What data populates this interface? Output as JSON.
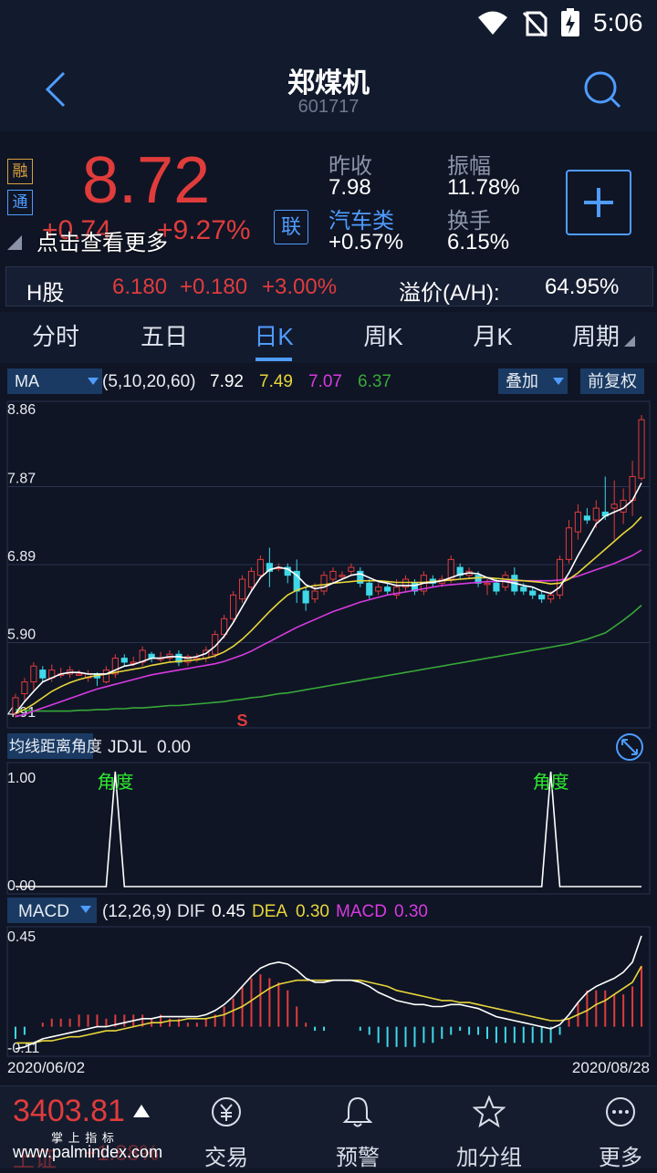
{
  "status": {
    "time": "5:06"
  },
  "header": {
    "title": "郑煤机",
    "code": "601717",
    "back_icon": "back-arrow-icon",
    "search_icon": "search-icon"
  },
  "quote": {
    "badge_rong": "融",
    "badge_tong": "通",
    "price": "8.72",
    "change": "+0.74",
    "change_pct": "+9.27%",
    "more_text": "点击查看更多",
    "lian_badge": "联",
    "prev_close_label": "昨收",
    "prev_close": "7.98",
    "amplitude_label": "振幅",
    "amplitude": "11.78%",
    "sector_label": "汽车类",
    "sector_change": "+0.57%",
    "turnover_label": "换手",
    "turnover": "6.15%",
    "add_icon": "plus-icon"
  },
  "hshare": {
    "label": "H股",
    "price": "6.180",
    "change": "+0.180",
    "change_pct": "+3.00%",
    "premium_label": "溢价(A/H):",
    "premium": "64.95%"
  },
  "tabs": [
    {
      "label": "分时"
    },
    {
      "label": "五日"
    },
    {
      "label": "日K"
    },
    {
      "label": "周K"
    },
    {
      "label": "月K"
    },
    {
      "label": "周期"
    }
  ],
  "ma": {
    "label": "MA",
    "params": "(5,10,20,60)",
    "v5": "7.92",
    "v10": "7.49",
    "v20": "7.07",
    "v60": "6.37",
    "overlay": "叠加",
    "adjust": "前复权"
  },
  "colors": {
    "up": "#e03c3c",
    "down": "#3fd8e8",
    "ma5": "#ffffff",
    "ma10": "#e8d53a",
    "ma20": "#d83ae0",
    "ma60": "#38a838"
  },
  "chart_data": [
    {
      "type": "candlestick",
      "yticks": [
        "8.86",
        "7.87",
        "6.89",
        "5.90",
        "4.91"
      ],
      "ylim": [
        4.91,
        8.86
      ],
      "candles": [
        [
          5.0,
          5.2,
          4.95,
          5.25
        ],
        [
          5.25,
          5.4,
          5.15,
          5.45
        ],
        [
          5.4,
          5.6,
          5.3,
          5.65
        ],
        [
          5.55,
          5.45,
          5.4,
          5.6
        ],
        [
          5.45,
          5.55,
          5.4,
          5.62
        ],
        [
          5.5,
          5.5,
          5.45,
          5.58
        ],
        [
          5.5,
          5.55,
          5.45,
          5.6
        ],
        [
          5.5,
          5.5,
          5.5,
          5.55
        ],
        [
          5.45,
          5.5,
          5.4,
          5.55
        ],
        [
          5.5,
          5.45,
          5.35,
          5.52
        ],
        [
          5.4,
          5.55,
          5.38,
          5.6
        ],
        [
          5.5,
          5.7,
          5.45,
          5.75
        ],
        [
          5.7,
          5.65,
          5.6,
          5.75
        ],
        [
          5.65,
          5.65,
          5.6,
          5.72
        ],
        [
          5.65,
          5.8,
          5.6,
          5.85
        ],
        [
          5.75,
          5.7,
          5.65,
          5.78
        ],
        [
          5.7,
          5.7,
          5.65,
          5.78
        ],
        [
          5.7,
          5.75,
          5.65,
          5.8
        ],
        [
          5.75,
          5.65,
          5.6,
          5.8
        ],
        [
          5.65,
          5.72,
          5.6,
          5.75
        ],
        [
          5.7,
          5.7,
          5.65,
          5.76
        ],
        [
          5.7,
          5.8,
          5.65,
          5.85
        ],
        [
          5.75,
          6.0,
          5.7,
          6.05
        ],
        [
          6.0,
          6.2,
          5.95,
          6.25
        ],
        [
          6.2,
          6.5,
          6.15,
          6.55
        ],
        [
          6.45,
          6.7,
          6.4,
          6.75
        ],
        [
          6.6,
          6.8,
          6.55,
          6.85
        ],
        [
          6.75,
          6.95,
          6.7,
          7.0
        ],
        [
          6.9,
          6.8,
          6.6,
          7.1
        ],
        [
          6.85,
          6.85,
          6.8,
          6.9
        ],
        [
          6.85,
          6.75,
          6.65,
          6.9
        ],
        [
          6.8,
          6.55,
          6.4,
          6.95
        ],
        [
          6.55,
          6.4,
          6.3,
          6.6
        ],
        [
          6.45,
          6.55,
          6.4,
          6.65
        ],
        [
          6.55,
          6.75,
          6.5,
          6.8
        ],
        [
          6.7,
          6.8,
          6.65,
          6.85
        ],
        [
          6.75,
          6.75,
          6.7,
          6.8
        ],
        [
          6.8,
          6.85,
          6.75,
          6.9
        ],
        [
          6.8,
          6.65,
          6.6,
          6.85
        ],
        [
          6.65,
          6.5,
          6.45,
          6.7
        ],
        [
          6.55,
          6.6,
          6.5,
          6.65
        ],
        [
          6.6,
          6.55,
          6.5,
          6.65
        ],
        [
          6.5,
          6.6,
          6.45,
          6.7
        ],
        [
          6.6,
          6.7,
          6.55,
          6.75
        ],
        [
          6.65,
          6.55,
          6.5,
          6.7
        ],
        [
          6.55,
          6.75,
          6.5,
          6.8
        ],
        [
          6.7,
          6.65,
          6.6,
          6.75
        ],
        [
          6.65,
          6.7,
          6.6,
          6.75
        ],
        [
          6.7,
          6.95,
          6.65,
          7.0
        ],
        [
          6.85,
          6.75,
          6.7,
          6.9
        ],
        [
          6.75,
          6.8,
          6.7,
          6.85
        ],
        [
          6.75,
          6.65,
          6.6,
          6.8
        ],
        [
          6.65,
          6.65,
          6.5,
          6.7
        ],
        [
          6.65,
          6.55,
          6.5,
          6.7
        ],
        [
          6.6,
          6.75,
          6.55,
          6.8
        ],
        [
          6.75,
          6.55,
          6.5,
          6.85
        ],
        [
          6.6,
          6.55,
          6.5,
          6.65
        ],
        [
          6.55,
          6.5,
          6.45,
          6.6
        ],
        [
          6.5,
          6.45,
          6.4,
          6.55
        ],
        [
          6.45,
          6.5,
          6.4,
          6.55
        ],
        [
          6.5,
          6.95,
          6.45,
          7.0
        ],
        [
          6.95,
          7.35,
          6.9,
          7.45
        ],
        [
          7.3,
          7.55,
          7.2,
          7.65
        ],
        [
          7.5,
          7.45,
          7.4,
          7.6
        ],
        [
          7.45,
          7.6,
          7.35,
          7.7
        ],
        [
          7.55,
          7.5,
          7.45,
          8.0
        ],
        [
          7.6,
          7.65,
          7.2,
          7.95
        ],
        [
          7.55,
          7.7,
          7.4,
          7.85
        ],
        [
          7.7,
          8.0,
          7.5,
          8.2
        ],
        [
          7.98,
          8.72,
          7.95,
          8.78
        ]
      ],
      "ma_lines": {
        "ma5": [
          5.0,
          5.15,
          5.28,
          5.4,
          5.45,
          5.5,
          5.52,
          5.52,
          5.5,
          5.5,
          5.5,
          5.55,
          5.6,
          5.62,
          5.66,
          5.7,
          5.7,
          5.72,
          5.72,
          5.7,
          5.72,
          5.76,
          5.85,
          5.98,
          6.15,
          6.35,
          6.55,
          6.72,
          6.82,
          6.85,
          6.83,
          6.75,
          6.63,
          6.58,
          6.6,
          6.65,
          6.7,
          6.75,
          6.77,
          6.72,
          6.67,
          6.65,
          6.62,
          6.62,
          6.62,
          6.65,
          6.66,
          6.68,
          6.72,
          6.76,
          6.78,
          6.77,
          6.72,
          6.68,
          6.67,
          6.65,
          6.62,
          6.6,
          6.55,
          6.52,
          6.6,
          6.78,
          7.0,
          7.2,
          7.4,
          7.5,
          7.55,
          7.6,
          7.7,
          7.92
        ],
        "ma10": [
          5.0,
          5.05,
          5.12,
          5.2,
          5.28,
          5.34,
          5.39,
          5.43,
          5.46,
          5.48,
          5.5,
          5.52,
          5.54,
          5.56,
          5.58,
          5.61,
          5.63,
          5.65,
          5.66,
          5.67,
          5.68,
          5.7,
          5.73,
          5.78,
          5.85,
          5.94,
          6.05,
          6.17,
          6.29,
          6.4,
          6.5,
          6.56,
          6.6,
          6.62,
          6.63,
          6.65,
          6.66,
          6.67,
          6.68,
          6.68,
          6.68,
          6.67,
          6.66,
          6.66,
          6.66,
          6.66,
          6.67,
          6.68,
          6.69,
          6.7,
          6.71,
          6.72,
          6.72,
          6.71,
          6.7,
          6.69,
          6.68,
          6.67,
          6.66,
          6.64,
          6.65,
          6.7,
          6.78,
          6.88,
          6.98,
          7.08,
          7.18,
          7.28,
          7.37,
          7.49
        ],
        "ma20": [
          4.96,
          4.99,
          5.03,
          5.07,
          5.11,
          5.15,
          5.19,
          5.23,
          5.27,
          5.31,
          5.34,
          5.37,
          5.4,
          5.43,
          5.46,
          5.49,
          5.51,
          5.53,
          5.55,
          5.57,
          5.59,
          5.61,
          5.63,
          5.66,
          5.7,
          5.74,
          5.79,
          5.85,
          5.91,
          5.97,
          6.03,
          6.09,
          6.14,
          6.19,
          6.24,
          6.29,
          6.33,
          6.37,
          6.41,
          6.44,
          6.47,
          6.5,
          6.52,
          6.54,
          6.56,
          6.58,
          6.6,
          6.62,
          6.63,
          6.64,
          6.65,
          6.66,
          6.67,
          6.67,
          6.68,
          6.68,
          6.68,
          6.68,
          6.68,
          6.68,
          6.69,
          6.71,
          6.74,
          6.78,
          6.82,
          6.86,
          6.9,
          6.95,
          7.0,
          7.07
        ],
        "ma60": [
          5.05,
          5.04,
          5.03,
          5.03,
          5.03,
          5.03,
          5.03,
          5.04,
          5.04,
          5.05,
          5.05,
          5.06,
          5.06,
          5.07,
          5.07,
          5.08,
          5.09,
          5.1,
          5.1,
          5.11,
          5.12,
          5.13,
          5.14,
          5.15,
          5.17,
          5.18,
          5.2,
          5.21,
          5.23,
          5.25,
          5.26,
          5.28,
          5.3,
          5.32,
          5.34,
          5.36,
          5.38,
          5.4,
          5.42,
          5.44,
          5.46,
          5.48,
          5.5,
          5.52,
          5.54,
          5.56,
          5.58,
          5.6,
          5.62,
          5.64,
          5.66,
          5.68,
          5.7,
          5.72,
          5.74,
          5.76,
          5.78,
          5.8,
          5.82,
          5.84,
          5.86,
          5.88,
          5.91,
          5.94,
          5.98,
          6.02,
          6.1,
          6.18,
          6.27,
          6.37
        ]
      },
      "marker": {
        "text": "S",
        "index": 25
      }
    },
    {
      "type": "line",
      "indicator": "均线距离角度",
      "name": "JDJL",
      "value": "0.00",
      "yticks": [
        "1.00",
        "0.00"
      ],
      "ylim": [
        0,
        1
      ],
      "spikes": [
        {
          "index": 11,
          "label": "角度"
        },
        {
          "index": 59,
          "label": "角度"
        }
      ]
    },
    {
      "type": "bar",
      "indicator": "MACD",
      "params": "(12,26,9)",
      "dif_label": "DIF",
      "dif": "0.45",
      "dea_label": "DEA",
      "dea": "0.30",
      "macd_label": "MACD",
      "macd": "0.30",
      "yticks": [
        "0.45",
        "-0.11"
      ],
      "ylim": [
        -0.11,
        0.45
      ],
      "dif_values": [
        -0.11,
        -0.1,
        -0.08,
        -0.06,
        -0.05,
        -0.04,
        -0.03,
        -0.02,
        -0.01,
        0.0,
        0.0,
        0.01,
        0.02,
        0.03,
        0.04,
        0.04,
        0.05,
        0.05,
        0.05,
        0.05,
        0.05,
        0.06,
        0.08,
        0.11,
        0.15,
        0.2,
        0.25,
        0.29,
        0.31,
        0.32,
        0.31,
        0.28,
        0.24,
        0.22,
        0.22,
        0.23,
        0.23,
        0.23,
        0.22,
        0.2,
        0.17,
        0.15,
        0.13,
        0.12,
        0.11,
        0.11,
        0.1,
        0.1,
        0.11,
        0.11,
        0.1,
        0.09,
        0.07,
        0.05,
        0.04,
        0.03,
        0.02,
        0.01,
        0.0,
        -0.01,
        0.01,
        0.06,
        0.12,
        0.17,
        0.2,
        0.22,
        0.24,
        0.27,
        0.32,
        0.45
      ],
      "dea_values": [
        -0.08,
        -0.08,
        -0.08,
        -0.07,
        -0.07,
        -0.06,
        -0.05,
        -0.05,
        -0.04,
        -0.03,
        -0.02,
        -0.02,
        -0.01,
        0.0,
        0.01,
        0.02,
        0.02,
        0.03,
        0.03,
        0.04,
        0.04,
        0.04,
        0.05,
        0.06,
        0.08,
        0.1,
        0.13,
        0.16,
        0.19,
        0.21,
        0.22,
        0.23,
        0.23,
        0.23,
        0.23,
        0.23,
        0.23,
        0.23,
        0.23,
        0.22,
        0.21,
        0.2,
        0.18,
        0.17,
        0.16,
        0.15,
        0.14,
        0.13,
        0.13,
        0.12,
        0.12,
        0.11,
        0.1,
        0.09,
        0.08,
        0.07,
        0.06,
        0.05,
        0.04,
        0.03,
        0.03,
        0.04,
        0.06,
        0.08,
        0.11,
        0.13,
        0.16,
        0.19,
        0.22,
        0.3
      ],
      "hist_values": [
        -0.06,
        -0.04,
        0.0,
        0.02,
        0.04,
        0.04,
        0.04,
        0.06,
        0.06,
        0.06,
        0.04,
        0.06,
        0.06,
        0.06,
        0.06,
        0.04,
        0.06,
        0.04,
        0.04,
        0.02,
        0.02,
        0.04,
        0.06,
        0.1,
        0.14,
        0.2,
        0.24,
        0.26,
        0.24,
        0.22,
        0.18,
        0.1,
        0.02,
        -0.02,
        -0.02,
        0.0,
        0.0,
        0.0,
        -0.02,
        -0.04,
        -0.08,
        -0.1,
        -0.1,
        -0.1,
        -0.1,
        -0.08,
        -0.08,
        -0.06,
        -0.04,
        -0.02,
        -0.04,
        -0.04,
        -0.06,
        -0.08,
        -0.08,
        -0.08,
        -0.08,
        -0.08,
        -0.08,
        -0.08,
        -0.04,
        0.04,
        0.12,
        0.18,
        0.18,
        0.18,
        0.16,
        0.16,
        0.2,
        0.3
      ],
      "x_start": "2020/06/02",
      "x_end": "2020/08/28"
    }
  ],
  "bottom": {
    "index_value": "3403.81",
    "index_sub": "掌 上 指 标",
    "index_label_back": "上证",
    "index_change_back": "+1.88%",
    "watermark": "www.palmindex.com",
    "items": [
      {
        "label": "交易",
        "icon": "trade-icon"
      },
      {
        "label": "预警",
        "icon": "bell-icon"
      },
      {
        "label": "加分组",
        "icon": "star-icon"
      },
      {
        "label": "更多",
        "icon": "more-icon"
      }
    ]
  }
}
